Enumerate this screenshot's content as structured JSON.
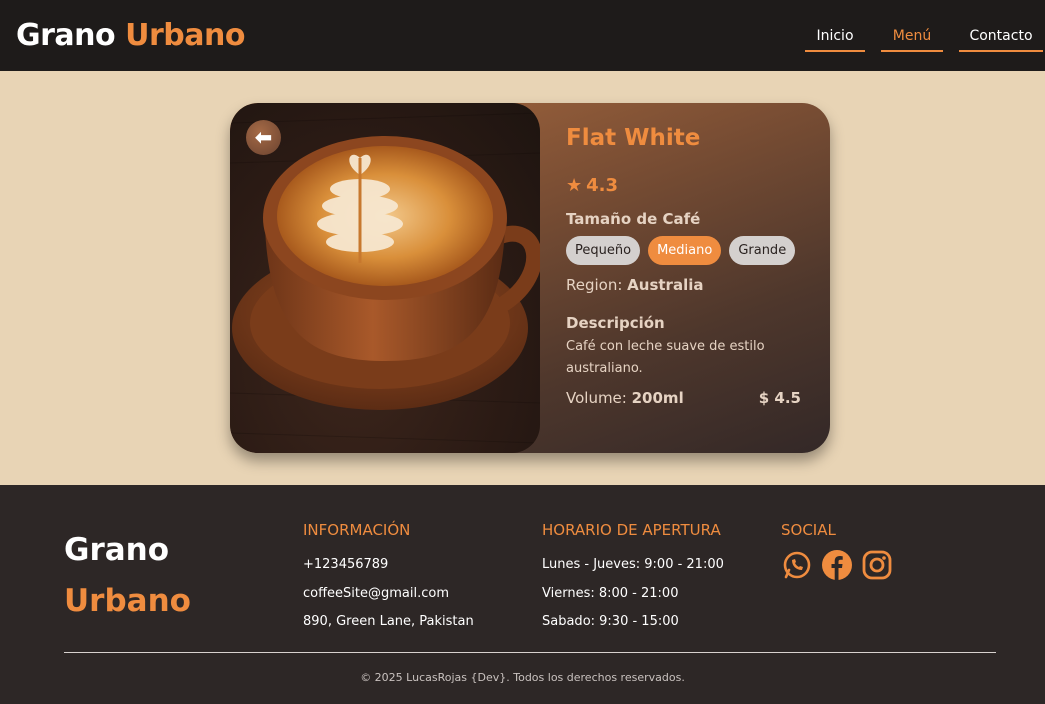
{
  "header": {
    "logo_part1": "Grano",
    "logo_part2": "Urbano",
    "nav": [
      {
        "label": "Inicio"
      },
      {
        "label": "Menú"
      },
      {
        "label": "Contacto"
      }
    ]
  },
  "product": {
    "back_icon": "arrow-left-icon",
    "name": "Flat White",
    "rating_star": "★",
    "rating": "4.3",
    "size_label": "Tamaño de Café",
    "sizes": [
      {
        "label": "Pequeño",
        "selected": false
      },
      {
        "label": "Mediano",
        "selected": true
      },
      {
        "label": "Grande",
        "selected": false
      }
    ],
    "region_label": "Region: ",
    "region": "Australia",
    "description_label": "Descripción",
    "description": "Café con leche suave de estilo australiano.",
    "volume_label": "Volume: ",
    "volume": "200ml",
    "price": "$ 4.5"
  },
  "footer": {
    "logo_part1": "Grano",
    "logo_part2": "Urbano",
    "info": {
      "heading": "INFORMACIÓN",
      "phone": "+123456789",
      "email": "coffeeSite@gmail.com",
      "address": "890, Green Lane, Pakistan"
    },
    "hours": {
      "heading": "HORARIO DE APERTURA",
      "line1": "Lunes - Jueves: 9:00 - 21:00",
      "line2": "Viernes: 8:00 - 21:00",
      "line3": "Sabado: 9:30 - 15:00"
    },
    "social": {
      "heading": "SOCIAL",
      "icons": [
        "whatsapp-icon",
        "facebook-icon",
        "instagram-icon"
      ]
    },
    "copyright": "© 2025 LucasRojas {Dev}. Todos los derechos reservados."
  },
  "colors": {
    "accent": "#ef8c3f",
    "header_bg": "#1e1b1a",
    "page_bg": "#e8d4b5",
    "footer_bg": "#2d2726"
  }
}
